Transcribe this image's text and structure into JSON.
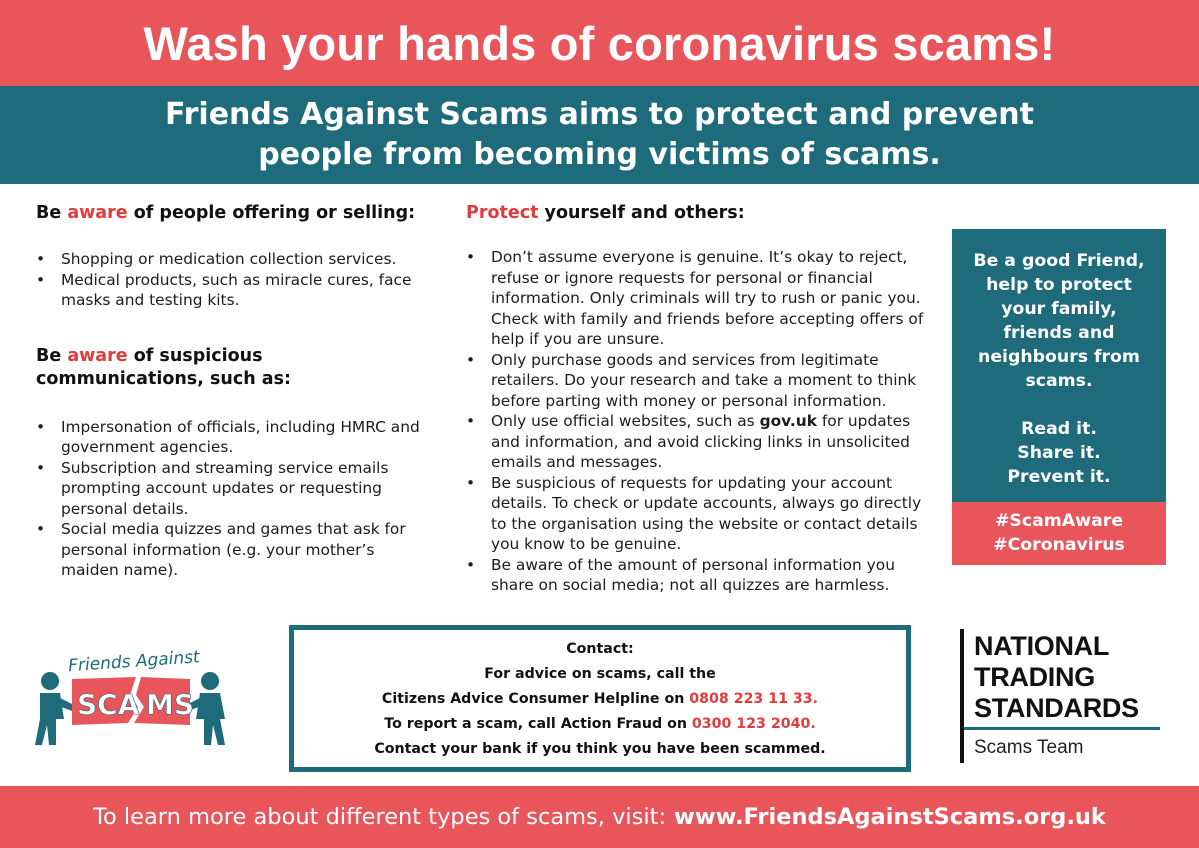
{
  "title": "Wash your hands of coronavirus scams!",
  "subtitle": {
    "line1": "Friends Against Scams aims to protect and prevent",
    "line2": "people from becoming victims of scams."
  },
  "aware_offering": {
    "prefix": "Be ",
    "highlight": "aware",
    "suffix": " of people offering or selling:",
    "items": [
      "Shopping or medication collection services.",
      "Medical products, such as miracle cures, face masks and testing kits."
    ]
  },
  "aware_communications": {
    "prefix": "Be ",
    "highlight": "aware",
    "suffix": " of suspicious communications, such as:",
    "items": [
      "Impersonation of officials, including HMRC and government agencies.",
      "Subscription and streaming service emails prompting account updates or requesting personal details.",
      "Social media quizzes and games that ask for personal information (e.g. your mother’s maiden name)."
    ]
  },
  "protect": {
    "highlight": "Protect",
    "suffix": " yourself and others:",
    "items": [
      "Don’t assume everyone is genuine. It’s okay to reject, refuse or ignore requests for personal or financial information. Only criminals will try to rush or panic you. Check with family and friends before accepting offers of help if you are unsure.",
      "Only purchase goods and services from legitimate retailers. Do your research and take a moment to think before parting with money or personal information.",
      {
        "before": "Only use official websites, such as ",
        "bold": "gov.uk",
        "after": " for updates and information, and avoid clicking links in unsolicited emails and messages."
      },
      "Be suspicious of requests for updating your account details. To check or update accounts, always go directly to the organisation using the website or contact details you know to be genuine.",
      "Be aware of the amount of personal information you share on social media; not all quizzes are harmless."
    ]
  },
  "friend_box": {
    "message": [
      "Be a good Friend,",
      "help to protect",
      "your family,",
      "friends and",
      "neighbours from",
      "scams."
    ],
    "actions": [
      "Read it.",
      "Share it.",
      "Prevent it."
    ],
    "hashtags": [
      "#ScamAware",
      "#Coronavirus"
    ]
  },
  "contact": {
    "heading": "Contact:",
    "line1": "For advice on scams, call the",
    "line2_text": "Citizens Advice Consumer Helpline on ",
    "line2_phone": "0808 223 11 33.",
    "line3_text": "To report a scam, call Action Fraud on ",
    "line3_phone": "0300 123 2040.",
    "line4": "Contact your bank if you think you have been scammed."
  },
  "logo_friends": {
    "text_top": "Friends Against",
    "text_left": "SCA",
    "text_right": "MS"
  },
  "logo_nts": {
    "lines": [
      "NATIONAL",
      "TRADING",
      "STANDARDS"
    ],
    "sub": "Scams Team"
  },
  "footer": {
    "text": "To learn more about different types of scams, visit:",
    "url": "www.FriendsAgainstScams.org.uk"
  },
  "colors": {
    "coral": "#e8565b",
    "teal": "#1e6b7b",
    "accent_red": "#e03c3c"
  }
}
